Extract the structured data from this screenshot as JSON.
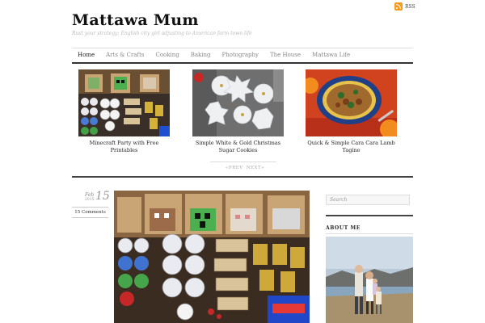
{
  "header": {
    "site_title": "Mattawa Mum",
    "tagline": "Rust your strategy; English city girl adjusting to American farm town life",
    "rss_label": "RSS"
  },
  "nav": {
    "items": [
      {
        "label": "Home",
        "active": true
      },
      {
        "label": "Arts & Crafts"
      },
      {
        "label": "Cooking"
      },
      {
        "label": "Baking"
      },
      {
        "label": "Photography"
      },
      {
        "label": "The House"
      },
      {
        "label": "Mattawa Life"
      }
    ]
  },
  "featured": [
    {
      "title": "Minecraft Party with Free Printables",
      "image_icon": "minecraft-party-photo"
    },
    {
      "title": "Simple White & Gold Christmas Sugar Cookies",
      "image_icon": "sugar-cookies-photo"
    },
    {
      "title": "Quick & Simple Cara Cara Lamb Tagine",
      "image_icon": "lamb-tagine-photo"
    }
  ],
  "pager": {
    "prev": "PREV",
    "next": "NEXT"
  },
  "post": {
    "month": "Feb",
    "year": "2015",
    "day": "15",
    "comments": "15 Comments"
  },
  "sidebar": {
    "search_placeholder": "Search",
    "about_title": "ABOUT ME"
  },
  "colors": {
    "accent": "#333333",
    "rss": "#f39b1c"
  }
}
